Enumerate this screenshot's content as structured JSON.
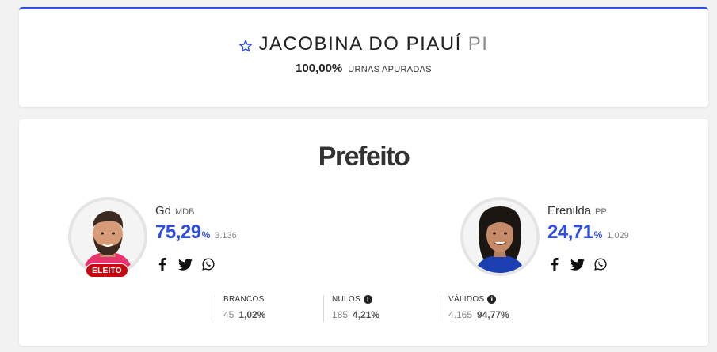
{
  "location": {
    "name": "JACOBINA DO PIAUÍ",
    "state": "PI",
    "percent_counted": "100,00%",
    "counted_label": "URNAS APURADAS"
  },
  "race": {
    "office": "Prefeito",
    "candidates": [
      {
        "name": "Gd",
        "party": "MDB",
        "percent": "75,29",
        "percent_sign": "%",
        "votes": "3.136",
        "badge": "ELEITO",
        "elected": true,
        "photo_icon": "candidate-photo-man"
      },
      {
        "name": "Erenilda",
        "party": "PP",
        "percent": "24,71",
        "percent_sign": "%",
        "votes": "1.029",
        "elected": false,
        "photo_icon": "candidate-photo-woman"
      }
    ],
    "share_icons": [
      "facebook-icon",
      "twitter-icon",
      "whatsapp-icon"
    ],
    "stats": {
      "brancos": {
        "label": "BRANCOS",
        "count": "45",
        "percent": "1,02%"
      },
      "nulos": {
        "label": "NULOS",
        "count": "185",
        "percent": "4,21%",
        "info_icon": "i"
      },
      "validos": {
        "label": "VÁLIDOS",
        "count": "4.165",
        "percent": "94,77%",
        "info_icon": "i"
      }
    }
  },
  "colors": {
    "accent": "#2f4de0",
    "elected_badge": "#c9060e",
    "background": "#f2f2f2"
  }
}
